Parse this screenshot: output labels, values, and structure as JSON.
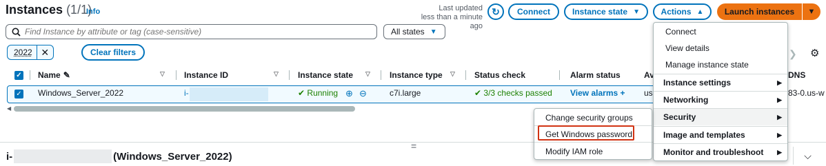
{
  "header": {
    "title": "Instances",
    "count": "(1/1)",
    "info": "Info",
    "last_updated_line1": "Last updated",
    "last_updated_line2": "less than a minute ago",
    "connect_label": "Connect",
    "instance_state_label": "Instance state",
    "actions_label": "Actions",
    "launch_label": "Launch instances"
  },
  "search": {
    "placeholder": "Find Instance by attribute or tag (case-sensitive)",
    "states_value": "All states"
  },
  "filters": {
    "token": "2022",
    "clear_label": "Clear filters"
  },
  "table": {
    "columns": [
      "Name",
      "Instance ID",
      "Instance state",
      "Instance type",
      "Status check",
      "Alarm status",
      "Av"
    ],
    "dns_col": "DNS",
    "row": {
      "name": "Windows_Server_2022",
      "id_prefix": "i-",
      "state": "Running",
      "type": "c7i.large",
      "status": "3/3 checks passed",
      "alarm": "View alarms",
      "az": "us",
      "dns": "83-0.us-w"
    }
  },
  "detail": {
    "id_prefix": "i-",
    "name": "(Windows_Server_2022)",
    "drag_handle": "="
  },
  "actions_menu": {
    "items": [
      "Connect",
      "View details",
      "Manage instance state"
    ],
    "groups": [
      "Instance settings",
      "Networking",
      "Security",
      "Image and templates",
      "Monitor and troubleshoot"
    ]
  },
  "security_menu": {
    "items": [
      "Change security groups",
      "Get Windows password",
      "Modify IAM role"
    ]
  },
  "colors": {
    "link": "#0073bb",
    "accent": "#ec7211",
    "success": "#1d8102",
    "highlight": "#d13212"
  }
}
